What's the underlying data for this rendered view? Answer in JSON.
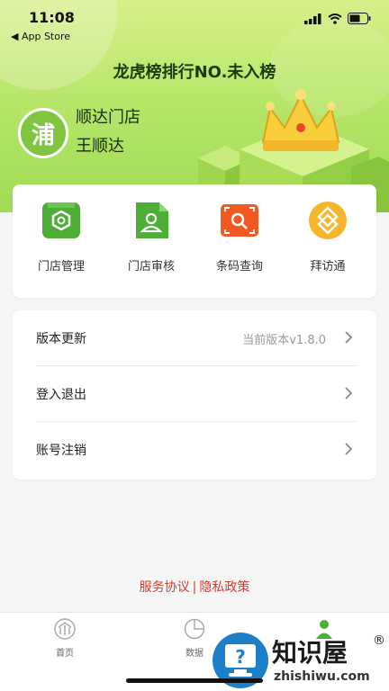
{
  "status_bar": {
    "time": "11:08",
    "back_label": "◀ App Store"
  },
  "header": {
    "rank_text": "龙虎榜排行NO.未入榜",
    "avatar_char": "浦",
    "store_name": "顺达门店",
    "user_name": "王顺达"
  },
  "shortcuts": [
    {
      "label": "门店管理",
      "icon": "store-box-icon",
      "color": "#4cae36"
    },
    {
      "label": "门店审核",
      "icon": "document-user-icon",
      "color": "#4cae36"
    },
    {
      "label": "条码查询",
      "icon": "barcode-search-icon",
      "color": "#f05a22"
    },
    {
      "label": "拜访通",
      "icon": "handshake-icon",
      "color": "#f6b62b"
    }
  ],
  "menu": [
    {
      "label": "版本更新",
      "value": "当前版本v1.8.0"
    },
    {
      "label": "登入退出",
      "value": ""
    },
    {
      "label": "账号注销",
      "value": ""
    }
  ],
  "agreements": {
    "service": "服务协议",
    "separator": "|",
    "privacy": "隐私政策"
  },
  "tabs": [
    {
      "label": "首页",
      "icon": "home-grid-icon"
    },
    {
      "label": "数据",
      "icon": "pie-chart-icon"
    },
    {
      "label": "",
      "icon": "person-icon"
    }
  ],
  "watermark": {
    "name": "知识屋",
    "registered": "®",
    "url": "zhishiwu.com",
    "badge": "?"
  },
  "colors": {
    "accent_green": "#4cae36",
    "link_red": "#d83a2a"
  }
}
